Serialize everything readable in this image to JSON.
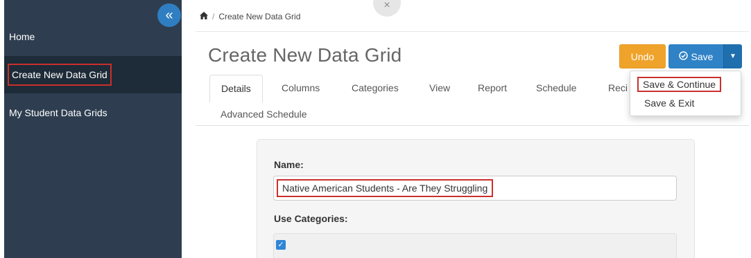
{
  "sidebar": {
    "collapse_icon": "double-chevron-left-icon",
    "collapse_glyph": "«",
    "items": [
      {
        "label": "Home"
      },
      {
        "label": "Create New Data Grid"
      },
      {
        "label": "My Student Data Grids"
      }
    ]
  },
  "modal": {
    "close_glyph": "×"
  },
  "breadcrumb": {
    "home_icon": "home-icon",
    "home_glyph": "🏠",
    "separator": "/",
    "current": "Create New Data Grid"
  },
  "header": {
    "title": "Create New Data Grid",
    "undo_label": "Undo",
    "save_icon": "check-circle-icon",
    "save_glyph": "⊘",
    "save_label": "Save",
    "caret_glyph": "▼"
  },
  "save_menu": {
    "items": [
      {
        "label": "Save & Continue"
      },
      {
        "label": "Save & Exit"
      }
    ]
  },
  "tabs": [
    {
      "label": "Details",
      "active": true
    },
    {
      "label": "Columns"
    },
    {
      "label": "Categories"
    },
    {
      "label": "View"
    },
    {
      "label": "Report"
    },
    {
      "label": "Schedule"
    },
    {
      "label": "Reci"
    },
    {
      "label": "Advanced Schedule"
    }
  ],
  "form": {
    "name_label": "Name:",
    "name_value": "Native American Students - Are They Struggling",
    "use_categories_label": "Use Categories:",
    "use_categories_checked": true,
    "check_glyph": "✓"
  },
  "colors": {
    "sidebar_bg": "#2e3e50",
    "sidebar_active_bg": "#1e2b38",
    "accent_blue": "#2f82c6",
    "undo_orange": "#f0a32b",
    "highlight_red": "#c9302c"
  }
}
